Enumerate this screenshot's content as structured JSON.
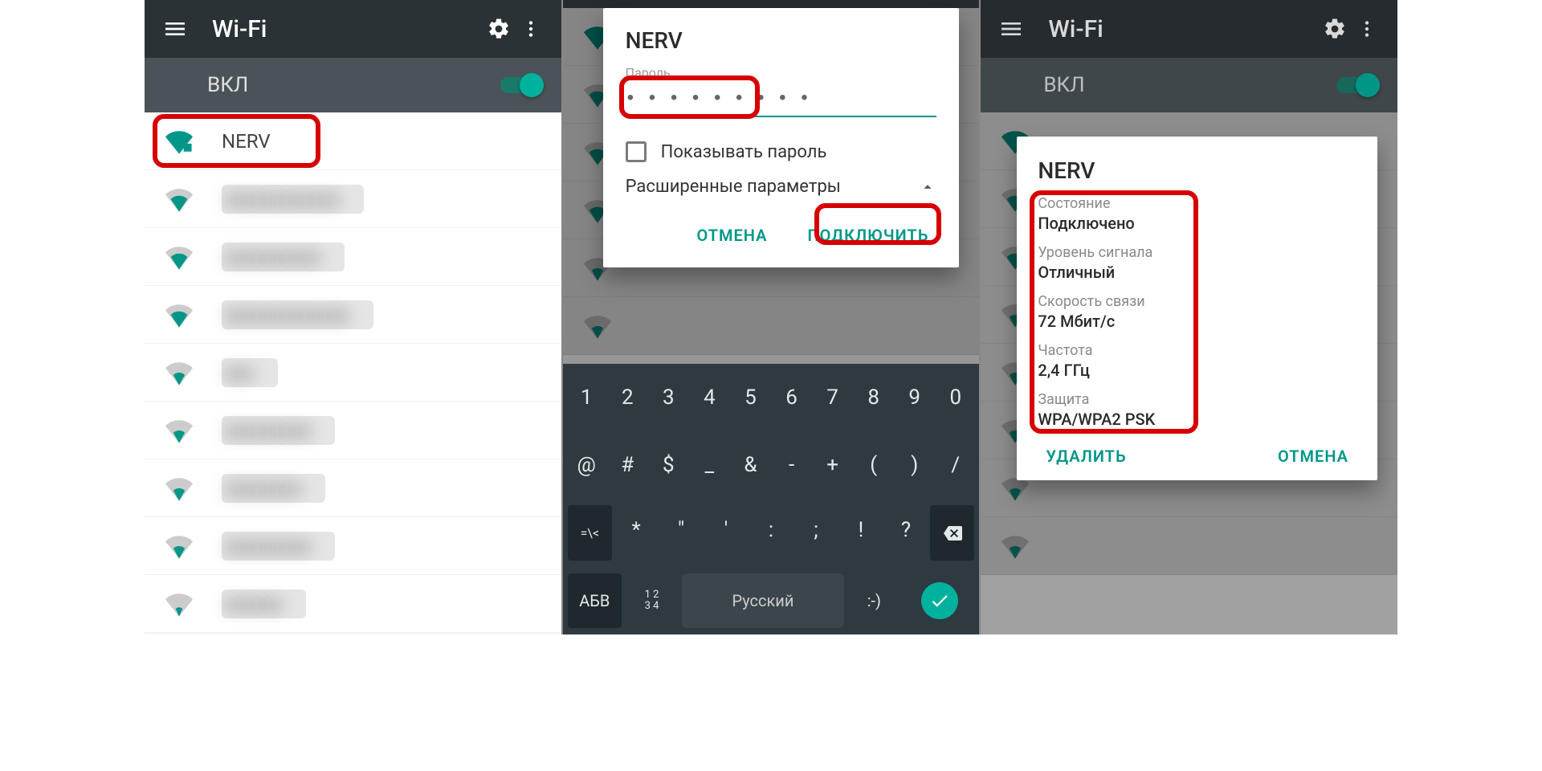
{
  "header": {
    "title": "Wi-Fi",
    "toggle_label": "ВКЛ"
  },
  "list1": {
    "items": [
      "NERV"
    ]
  },
  "dialog_connect": {
    "title": "NERV",
    "password_label": "Пароль",
    "password_value": "• • • • • • • • •",
    "show_pw": "Показывать пароль",
    "advanced": "Расширенные параметры",
    "cancel": "ОТМЕНА",
    "connect": "ПОДКЛЮЧИТЬ"
  },
  "dialog_info": {
    "title": "NERV",
    "rows": [
      {
        "label": "Состояние",
        "value": "Подключено"
      },
      {
        "label": "Уровень сигнала",
        "value": "Отличный"
      },
      {
        "label": "Скорость связи",
        "value": "72 Мбит/с"
      },
      {
        "label": "Частота",
        "value": "2,4 ГГц"
      },
      {
        "label": "Защита",
        "value": "WPA/WPA2 PSK"
      }
    ],
    "forget": "УДАЛИТЬ",
    "cancel": "ОТМЕНА"
  },
  "keyboard": {
    "row1": [
      "1",
      "2",
      "3",
      "4",
      "5",
      "6",
      "7",
      "8",
      "9",
      "0"
    ],
    "row2": [
      "@",
      "#",
      "$",
      "_",
      "&",
      "-",
      "+",
      "(",
      ")",
      "/"
    ],
    "row2_shift": "=\\<",
    "row3": [
      "*",
      "\"",
      "'",
      ":",
      ";",
      "!",
      "?"
    ],
    "abc": "АБВ",
    "sub": "1 2\n3 4",
    "space": "Русский",
    "emoji": ":-)"
  }
}
